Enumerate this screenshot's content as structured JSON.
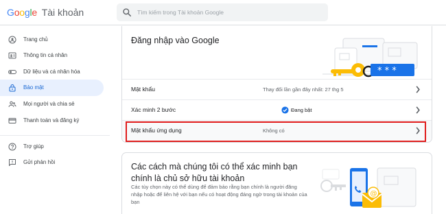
{
  "header": {
    "logo_brand": "Google",
    "logo_app": "Tài khoản",
    "search_placeholder": "Tìm kiếm trong Tài khoản Google"
  },
  "sidebar": {
    "items": [
      {
        "label": "Trang chủ",
        "icon": "home-icon",
        "active": false
      },
      {
        "label": "Thông tin cá nhân",
        "icon": "person-id-icon",
        "active": false
      },
      {
        "label": "Dữ liệu và cá nhân hóa",
        "icon": "toggle-icon",
        "active": false
      },
      {
        "label": "Bảo mật",
        "icon": "lock-icon",
        "active": true
      },
      {
        "label": "Mọi người và chia sẻ",
        "icon": "people-icon",
        "active": false
      },
      {
        "label": "Thanh toán và đăng ký",
        "icon": "credit-card-icon",
        "active": false
      },
      {
        "label": "Trợ giúp",
        "icon": "help-icon",
        "active": false
      },
      {
        "label": "Gửi phản hồi",
        "icon": "feedback-icon",
        "active": false
      }
    ]
  },
  "signin_card": {
    "title": "Đăng nhập vào Google",
    "rows": [
      {
        "label": "Mật khẩu",
        "value": "Thay đổi lần gần đây nhất: 27 thg 5"
      },
      {
        "label": "Xác minh 2 bước",
        "value": "Đang bật",
        "status_icon": "check-circle-icon"
      },
      {
        "label": "Mật khẩu ứng dụng",
        "value": "Không có"
      }
    ]
  },
  "verify_card": {
    "title": "Các cách mà chúng tôi có thể xác minh bạn chính là chủ sở hữu tài khoản",
    "description": "Các tùy chọn này có thể dùng để đảm bảo rằng bạn chính là người đăng nhập hoặc để liên hệ với bạn nếu có hoạt động đáng ngờ trong tài khoản của bạn"
  },
  "colors": {
    "accent": "#1a73e8",
    "active_bg": "#e8f0fe",
    "highlight": "#e01b1b"
  }
}
